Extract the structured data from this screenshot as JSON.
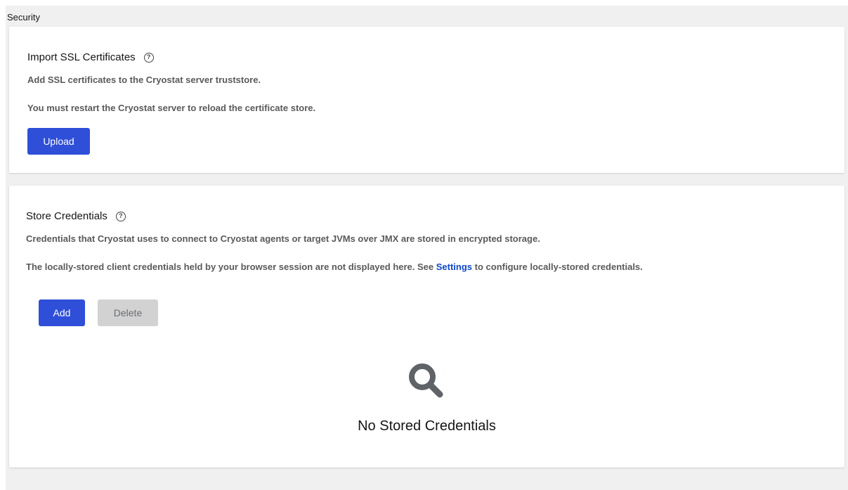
{
  "page": {
    "title": "Security"
  },
  "ssl_card": {
    "title": "Import SSL Certificates",
    "description_1": "Add SSL certificates to the Cryostat server truststore.",
    "description_2": "You must restart the Cryostat server to reload the certificate store.",
    "upload_label": "Upload"
  },
  "credentials_card": {
    "title": "Store Credentials",
    "description_1": "Credentials that Cryostat uses to connect to Cryostat agents or target JVMs over JMX are stored in encrypted storage.",
    "description_2_before": "The locally-stored client credentials held by your browser session are not displayed here. See ",
    "description_2_link": "Settings",
    "description_2_after": " to configure locally-stored credentials.",
    "add_label": "Add",
    "delete_label": "Delete",
    "empty_state_icon": "search-icon",
    "empty_state_title": "No Stored Credentials"
  },
  "colors": {
    "primary": "#2f4fd9",
    "link": "#0d47c7",
    "disabled_bg": "#d2d2d2",
    "page_bg": "#f0f0f0"
  }
}
